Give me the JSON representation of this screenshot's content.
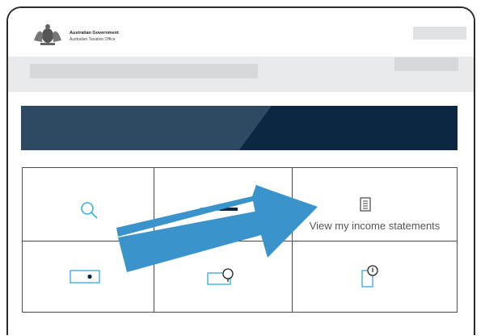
{
  "header": {
    "logo_line1": "Australian Government",
    "logo_line2": "Australian Taxation Office"
  },
  "tiles": [
    {
      "icon": "search-icon",
      "label": ""
    },
    {
      "icon": "progress-bar-icon",
      "label": ""
    },
    {
      "icon": "document-icon",
      "label": "View my income statements"
    },
    {
      "icon": "card-icon",
      "label": ""
    },
    {
      "icon": "search-card-icon",
      "label": ""
    },
    {
      "icon": "search-document-icon",
      "label": ""
    }
  ],
  "colors": {
    "accent": "#3db0e0",
    "banner_dark": "#0b2742",
    "banner_light": "#2e4a63",
    "arrow": "#3b93cc"
  }
}
